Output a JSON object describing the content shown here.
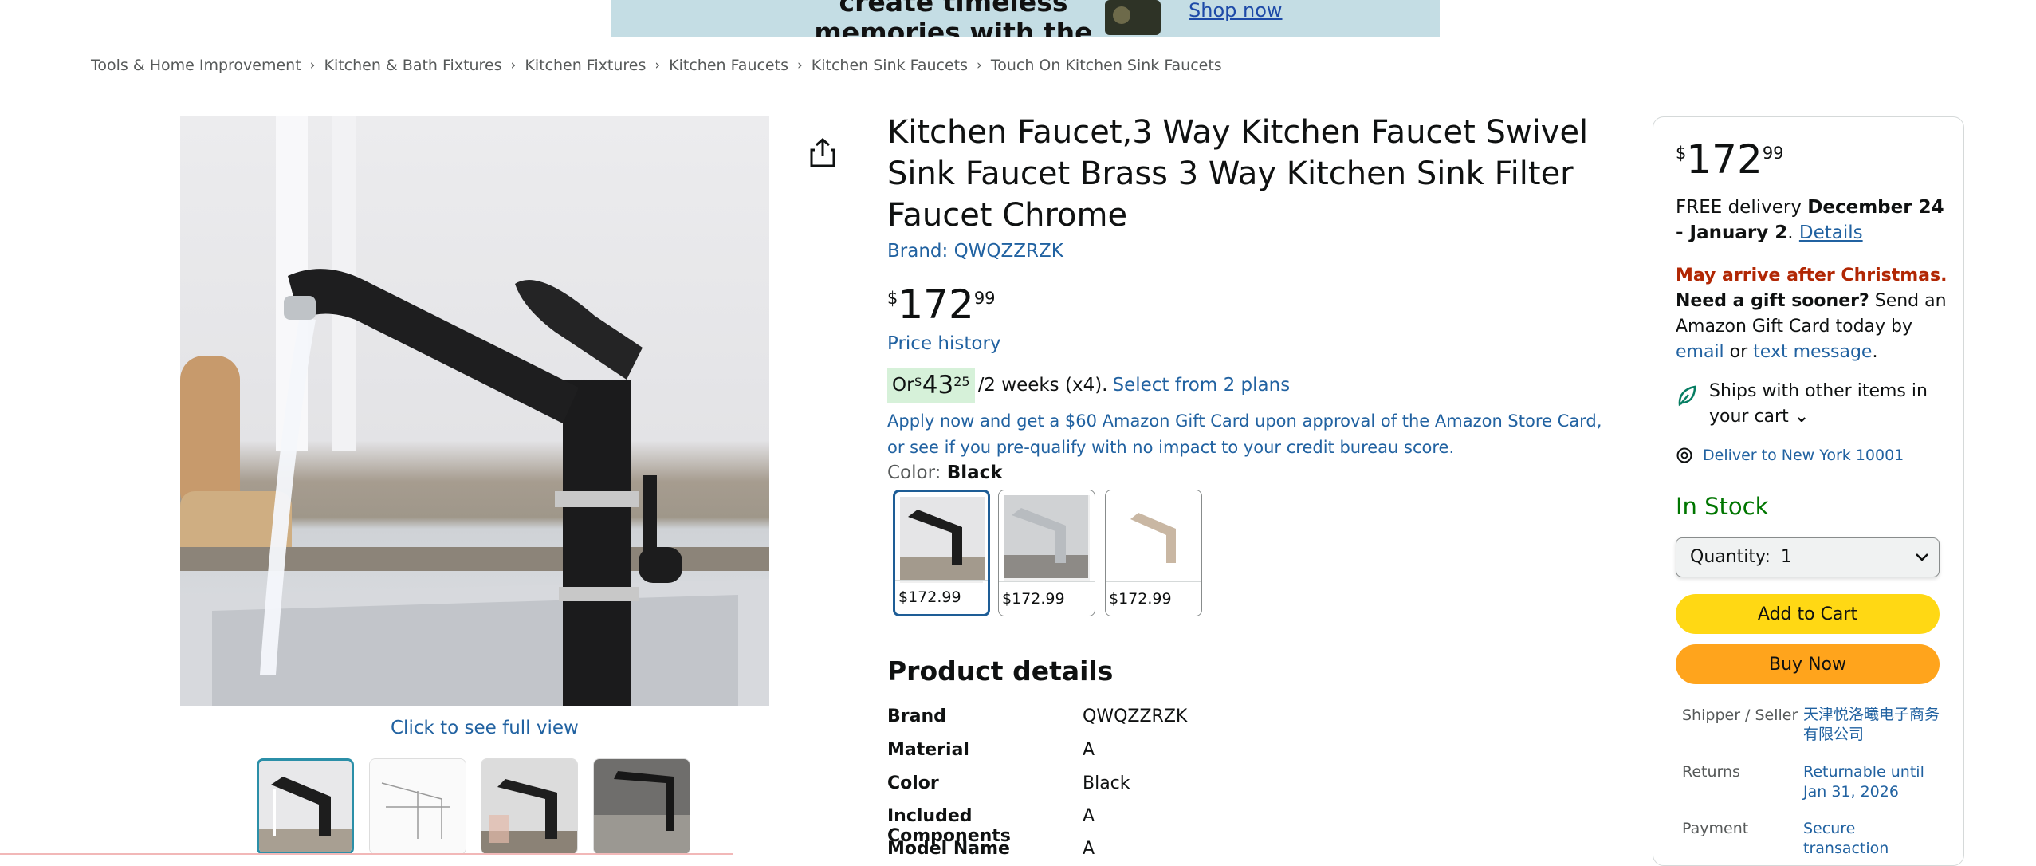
{
  "ad": {
    "headline": "create timeless memories with the perfect camera",
    "cta": "Shop now"
  },
  "breadcrumb": [
    "Tools & Home Improvement",
    "Kitchen & Bath Fixtures",
    "Kitchen Fixtures",
    "Kitchen Faucets",
    "Kitchen Sink Faucets",
    "Touch On Kitchen Sink Faucets"
  ],
  "gallery": {
    "full_view_label": "Click to see full view",
    "thumbnail_count": 4,
    "selected_thumbnail": 1
  },
  "product": {
    "title": "Kitchen Faucet,3 Way Kitchen Faucet Swivel Sink Faucet Brass 3 Way Kitchen Sink Filter Faucet Chrome",
    "brand_link": "Brand: QWQZZRZK",
    "price": {
      "symbol": "$",
      "whole": "172",
      "fraction": "99"
    },
    "price_history_label": "Price history",
    "installment": {
      "prefix": "Or ",
      "symbol": "$",
      "whole": "43",
      "fraction": "25",
      "suffix": "/2 weeks (x4).",
      "link": "Select from 2 plans"
    },
    "apply_text": "Apply now and get a $60 Amazon Gift Card upon approval of the Amazon Store Card, or see if you pre-qualify with no impact to your credit bureau score.",
    "color_label": "Color:",
    "color_value": "Black",
    "color_options": [
      {
        "price": "$172.99",
        "selected": true
      },
      {
        "price": "$172.99",
        "selected": false
      },
      {
        "price": "$172.99",
        "selected": false
      }
    ]
  },
  "product_details": {
    "heading": "Product details",
    "rows": [
      {
        "key": "Brand",
        "value": "QWQZZRZK"
      },
      {
        "key": "Material",
        "value": "A"
      },
      {
        "key": "Color",
        "value": "Black"
      },
      {
        "key": "Included Components",
        "value": "A"
      },
      {
        "key": "Model Name",
        "value": "A"
      }
    ]
  },
  "buy_box": {
    "price": {
      "symbol": "$",
      "whole": "172",
      "fraction": "99"
    },
    "delivery_prefix": "FREE delivery ",
    "delivery_dates": "December 24 - January 2",
    "delivery_dot": ". ",
    "details_link": "Details",
    "christmas_warning": "May arrive after Christmas.",
    "gift_question": "Need a gift sooner?",
    "gift_text": " Send an Amazon Gift Card today by ",
    "email_link": "email",
    "or_text": " or ",
    "text_link": "text message",
    "period": ".",
    "ships_text": "Ships with other items in your cart",
    "deliver_to": "Deliver to New York 10001",
    "stock": "In Stock",
    "quantity_label": "Quantity:",
    "quantity_value": "1",
    "add_to_cart": "Add to Cart",
    "buy_now": "Buy Now",
    "meta": [
      {
        "label": "Shipper / Seller",
        "value": "天津悦洛曦电子商务有限公司"
      },
      {
        "label": "Returns",
        "value": "Returnable until Jan 31, 2026"
      },
      {
        "label": "Payment",
        "value": "Secure transaction"
      }
    ]
  },
  "colors": {
    "link": "#2162a1",
    "add_to_cart_bg": "#ffd814",
    "buy_now_bg": "#ffa41c",
    "in_stock": "#007600",
    "warning": "#b12704",
    "installment_bg": "#d6f1d9"
  }
}
